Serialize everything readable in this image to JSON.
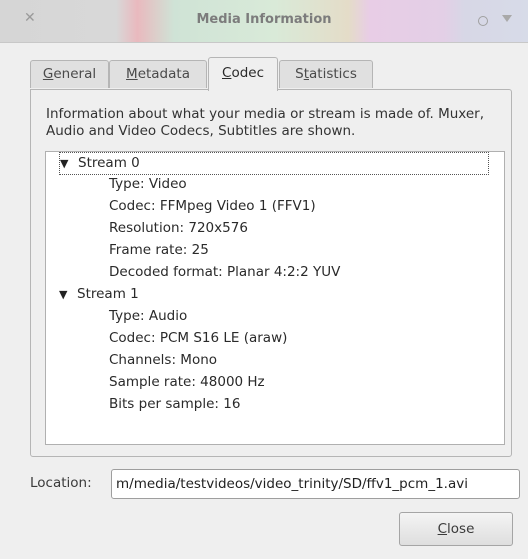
{
  "window": {
    "title": "Media Information"
  },
  "tabs": [
    {
      "label": "General",
      "mnemonic": "G",
      "rest": "eneral"
    },
    {
      "label": "Metadata",
      "mnemonic": "M",
      "rest": "etadata"
    },
    {
      "label": "Codec",
      "mnemonic": "C",
      "rest": "odec"
    },
    {
      "label": "Statistics",
      "pre": "S",
      "mnemonic": "t",
      "rest": "atistics"
    }
  ],
  "active_tab": "Codec",
  "codec": {
    "description": "Information about what your media or stream is made of. Muxer, Audio and Video Codecs, Subtitles are shown.",
    "streams": [
      {
        "label": "Stream 0",
        "details": [
          "Type: Video",
          "Codec: FFMpeg Video 1 (FFV1)",
          "Resolution: 720x576",
          "Frame rate: 25",
          "Decoded format: Planar 4:2:2 YUV"
        ]
      },
      {
        "label": "Stream 1",
        "details": [
          "Type: Audio",
          "Codec: PCM S16 LE (araw)",
          "Channels: Mono",
          "Sample rate: 48000 Hz",
          "Bits per sample: 16"
        ]
      }
    ]
  },
  "location": {
    "label": "Location:",
    "value": "m/media/testvideos/video_trinity/SD/ffv1_pcm_1.avi"
  },
  "buttons": {
    "close": {
      "mnemonic": "C",
      "rest": "lose"
    }
  },
  "icons": {
    "expand": "▼",
    "close_window": "✕"
  }
}
